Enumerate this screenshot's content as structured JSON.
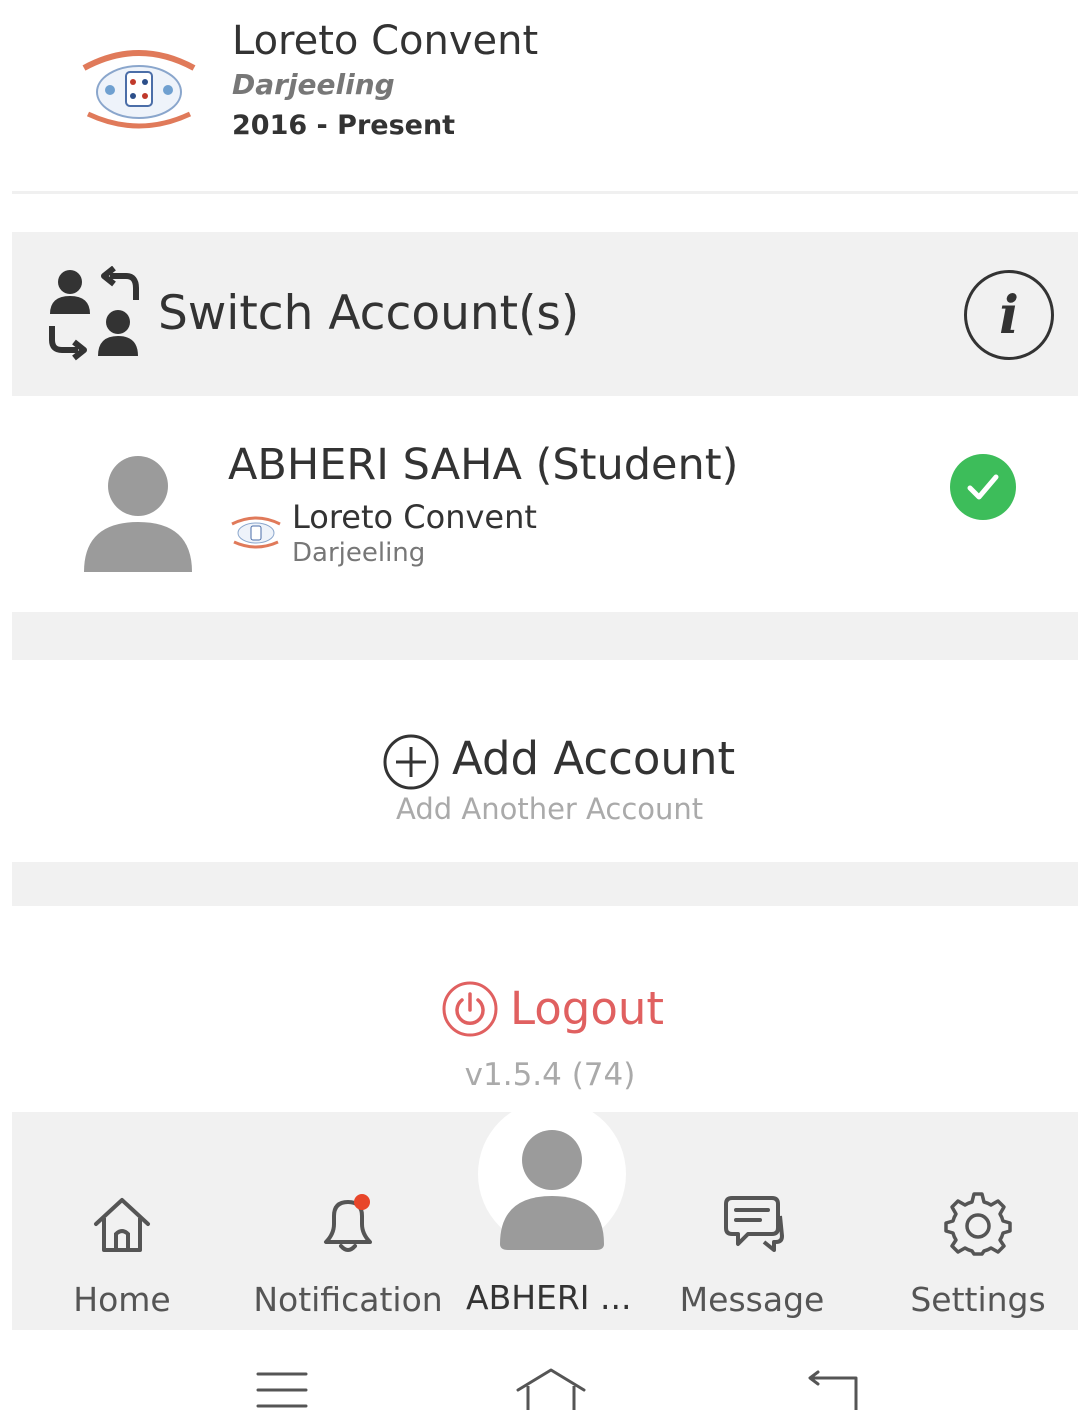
{
  "school": {
    "name": "Loreto Convent",
    "city": "Darjeeling",
    "years": "2016 - Present"
  },
  "switch_account": {
    "title": "Switch Account(s)",
    "info_icon": "info-icon"
  },
  "account": {
    "name": "ABHERI SAHA (Student)",
    "school": "Loreto Convent",
    "city": "Darjeeling",
    "active": true
  },
  "add_account": {
    "label": "Add Account",
    "sublabel": "Add Another Account"
  },
  "logout": {
    "label": "Logout",
    "version": "v1.5.4 (74)"
  },
  "bottom_nav": {
    "items": [
      {
        "label": "Home",
        "icon": "home-icon"
      },
      {
        "label": "Notification",
        "icon": "bell-icon"
      },
      {
        "label": "ABHERI ...",
        "icon": "avatar"
      },
      {
        "label": "Message",
        "icon": "message-icon"
      },
      {
        "label": "Settings",
        "icon": "gear-icon"
      }
    ]
  },
  "colors": {
    "panel": "#f1f1f1",
    "active_check": "#3dbd5a",
    "logout": "#e06060",
    "notification_dot": "#e8462a"
  }
}
